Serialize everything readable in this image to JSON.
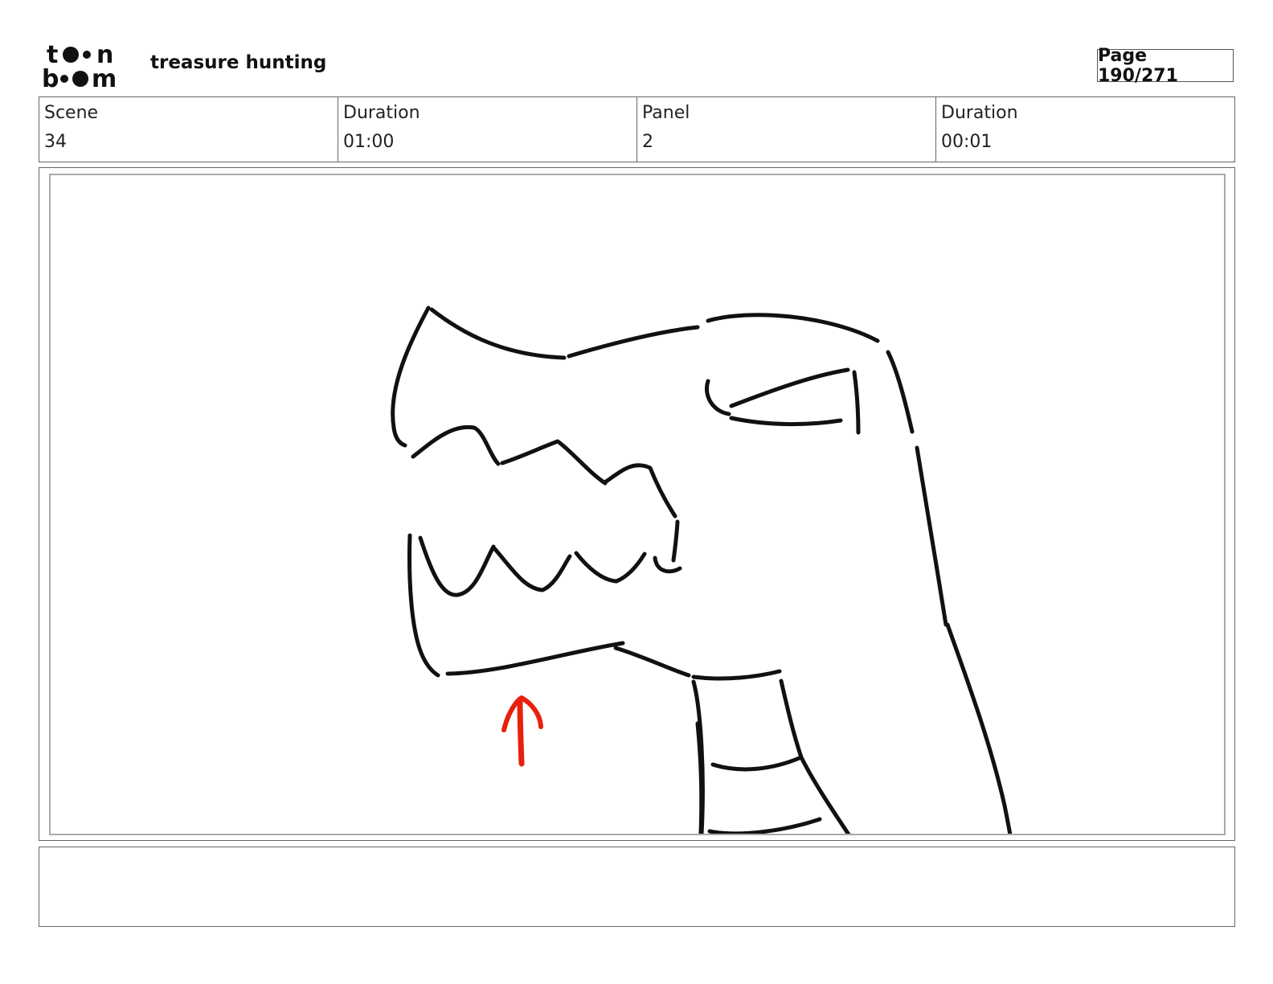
{
  "header": {
    "logo_text": "toon boom",
    "project_title": "treasure hunting",
    "page_label": "Page 190/271"
  },
  "info": [
    {
      "label": "Scene",
      "value": "34"
    },
    {
      "label": "Duration",
      "value": "01:00"
    },
    {
      "label": "Panel",
      "value": "2"
    },
    {
      "label": "Duration",
      "value": "00:01"
    }
  ],
  "panel": {
    "drawing": "dinosaur-head-sketch",
    "annotation": "up-arrow",
    "colors": {
      "ink": "#111111",
      "annotation": "#e8210c"
    }
  },
  "notes": {
    "text": ""
  }
}
